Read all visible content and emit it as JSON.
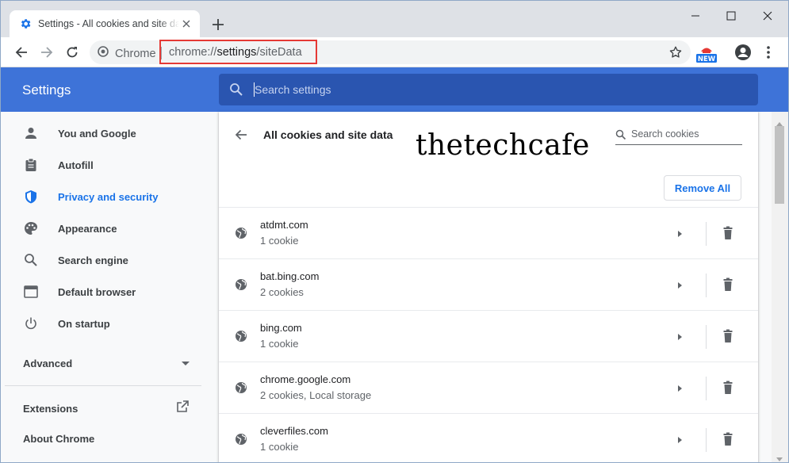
{
  "tab": {
    "title": "Settings - All cookies and site data",
    "favicon": "gear-icon"
  },
  "toolbar": {
    "chip_label": "Chrome",
    "url_prefix": "chrome://",
    "url_main": "settings",
    "url_suffix": "/siteData",
    "extension_badge": "NEW"
  },
  "settings": {
    "title": "Settings",
    "search_placeholder": "Search settings"
  },
  "sidebar": {
    "items": [
      {
        "label": "You and Google",
        "icon": "person-icon"
      },
      {
        "label": "Autofill",
        "icon": "clipboard-icon"
      },
      {
        "label": "Privacy and security",
        "icon": "shield-icon",
        "active": true
      },
      {
        "label": "Appearance",
        "icon": "palette-icon"
      },
      {
        "label": "Search engine",
        "icon": "search-icon"
      },
      {
        "label": "Default browser",
        "icon": "browser-icon"
      },
      {
        "label": "On startup",
        "icon": "power-icon"
      }
    ],
    "advanced_label": "Advanced",
    "extensions_label": "Extensions",
    "about_label": "About Chrome"
  },
  "main": {
    "title": "All cookies and site data",
    "watermark": "thetechcafe",
    "search_cookies_placeholder": "Search cookies",
    "remove_all_label": "Remove All",
    "sites": [
      {
        "name": "atdmt.com",
        "detail": "1 cookie"
      },
      {
        "name": "bat.bing.com",
        "detail": "2 cookies"
      },
      {
        "name": "bing.com",
        "detail": "1 cookie"
      },
      {
        "name": "chrome.google.com",
        "detail": "2 cookies, Local storage"
      },
      {
        "name": "cleverfiles.com",
        "detail": "1 cookie"
      }
    ]
  },
  "colors": {
    "header_blue": "#3e73d8",
    "search_blue": "#2a55b0",
    "active_link": "#1a73e8",
    "url_highlight": "#e53935"
  }
}
